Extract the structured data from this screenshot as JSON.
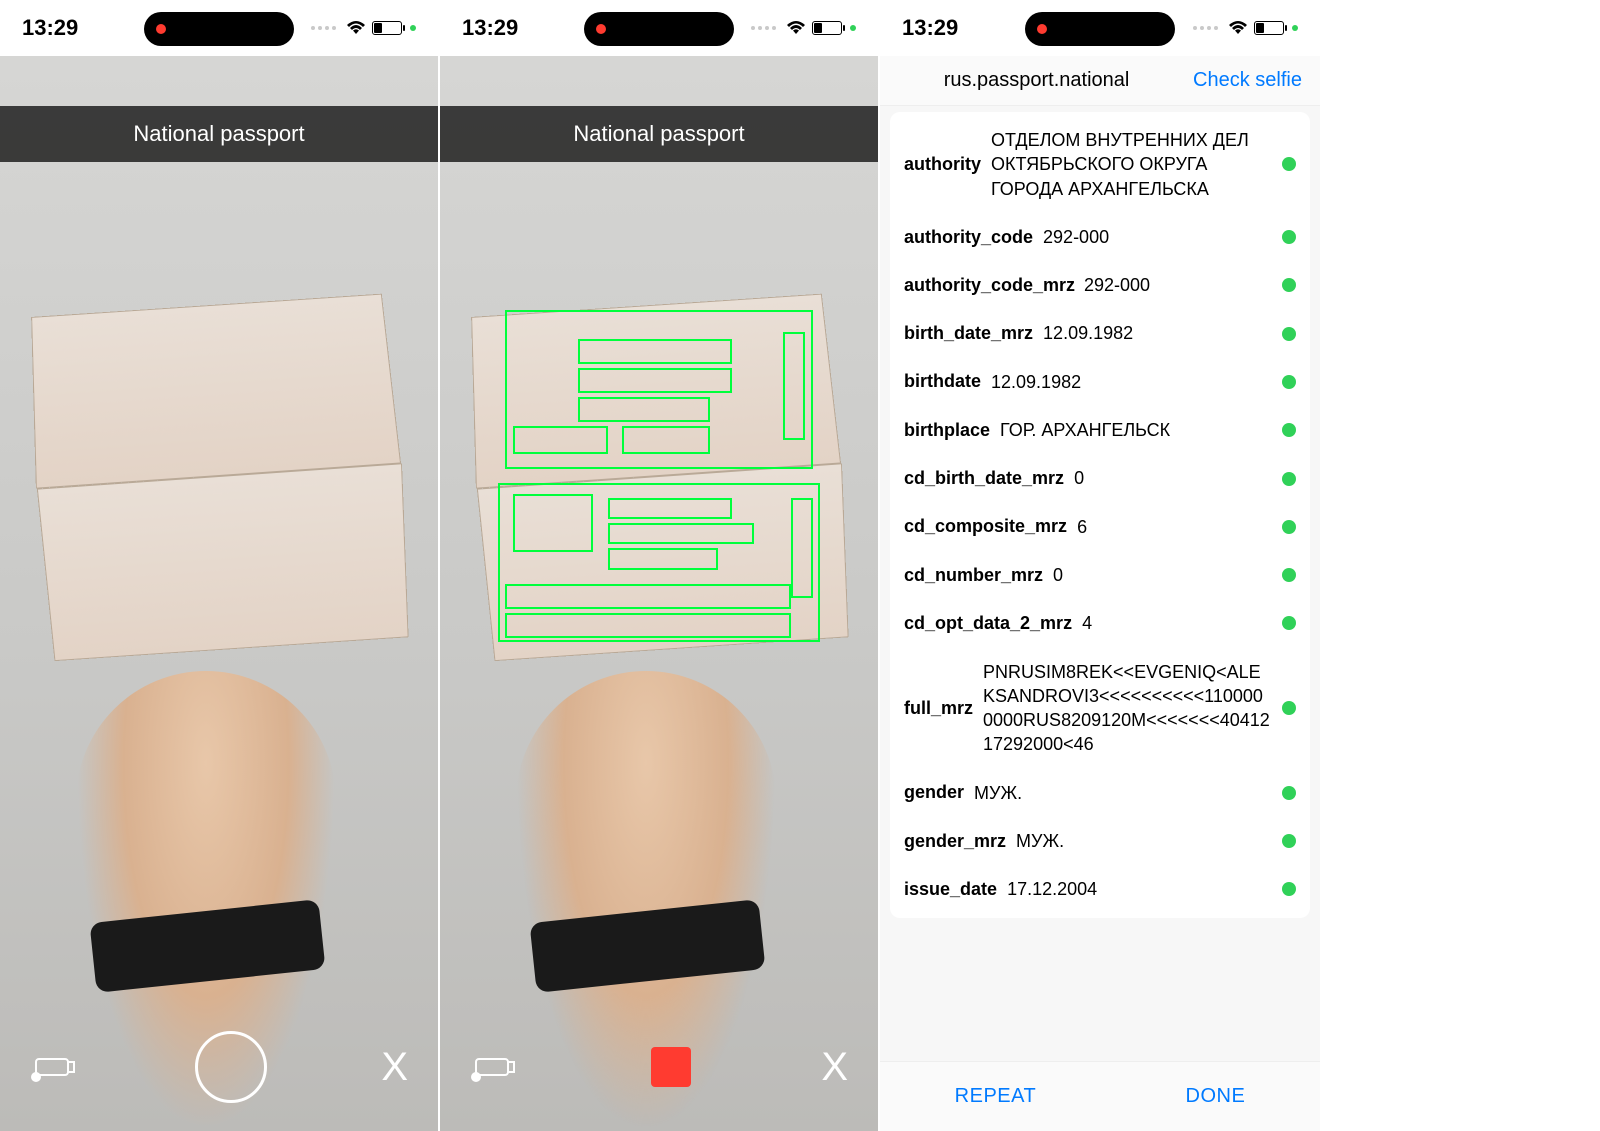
{
  "status": {
    "time": "13:29"
  },
  "camera": {
    "title": "National passport",
    "controls": {
      "flash": "flash",
      "shutter": "shutter",
      "stop": "stop",
      "close": "X"
    }
  },
  "results": {
    "doc_type": "rus.passport.national",
    "check_selfie_label": "Check selfie",
    "fields": [
      {
        "key": "authority",
        "value": "ОТДЕЛОМ ВНУТРЕННИХ ДЕЛ ОКТЯБРЬСКОГО ОКРУГА ГОРОДА АРХАНГЕЛЬСКА",
        "ok": true
      },
      {
        "key": "authority_code",
        "value": "292-000",
        "ok": true
      },
      {
        "key": "authority_code_mrz",
        "value": "292-000",
        "ok": true
      },
      {
        "key": "birth_date_mrz",
        "value": "12.09.1982",
        "ok": true
      },
      {
        "key": "birthdate",
        "value": "12.09.1982",
        "ok": true
      },
      {
        "key": "birthplace",
        "value": "ГОР. АРХАНГЕЛЬСК",
        "ok": true
      },
      {
        "key": "cd_birth_date_mrz",
        "value": "0",
        "ok": true
      },
      {
        "key": "cd_composite_mrz",
        "value": "6",
        "ok": true
      },
      {
        "key": "cd_number_mrz",
        "value": "0",
        "ok": true
      },
      {
        "key": "cd_opt_data_2_mrz",
        "value": "4",
        "ok": true
      },
      {
        "key": "full_mrz",
        "value": "PNRUSIM8REK<<EVGENIQ<ALEKSANDROVI3<<<<<<<<<<1100000000RUS8209120M<<<<<<<4041217292000<46",
        "ok": true
      },
      {
        "key": "gender",
        "value": "МУЖ.",
        "ok": true
      },
      {
        "key": "gender_mrz",
        "value": "МУЖ.",
        "ok": true
      },
      {
        "key": "issue_date",
        "value": "17.12.2004",
        "ok": true
      }
    ],
    "footer": {
      "repeat": "REPEAT",
      "done": "DONE"
    }
  }
}
